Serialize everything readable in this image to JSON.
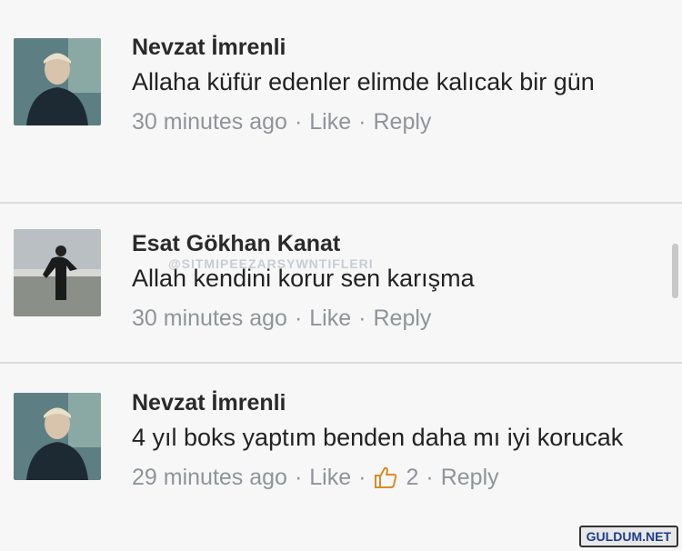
{
  "comments": [
    {
      "author": "Nevzat İmrenli",
      "text": "Allaha küfür edenler elimde kalıcak bir gün",
      "time": "30 minutes ago",
      "like": "Like",
      "reply": "Reply",
      "avatar": "man-portrait-avatar"
    },
    {
      "author": "Esat Gökhan Kanat",
      "text": "Allah kendini korur sen karışma",
      "time": "30 minutes ago",
      "like": "Like",
      "reply": "Reply",
      "avatar": "beach-figure-avatar"
    },
    {
      "author": "Nevzat İmrenli",
      "text": "4 yıl boks yaptım benden daha mı iyi korucak",
      "time": "29 minutes ago",
      "like": "Like",
      "reaction_count": "2",
      "reply": "Reply",
      "avatar": "man-portrait-avatar"
    }
  ],
  "separator": "·",
  "watermark": "@SITMIPEEZARSYWNTIFLERI",
  "site_logo": "GULDUM.NET",
  "colors": {
    "background": "#f7f7f7",
    "meta_text": "#8f949b",
    "name_text": "#2a2a2a"
  }
}
